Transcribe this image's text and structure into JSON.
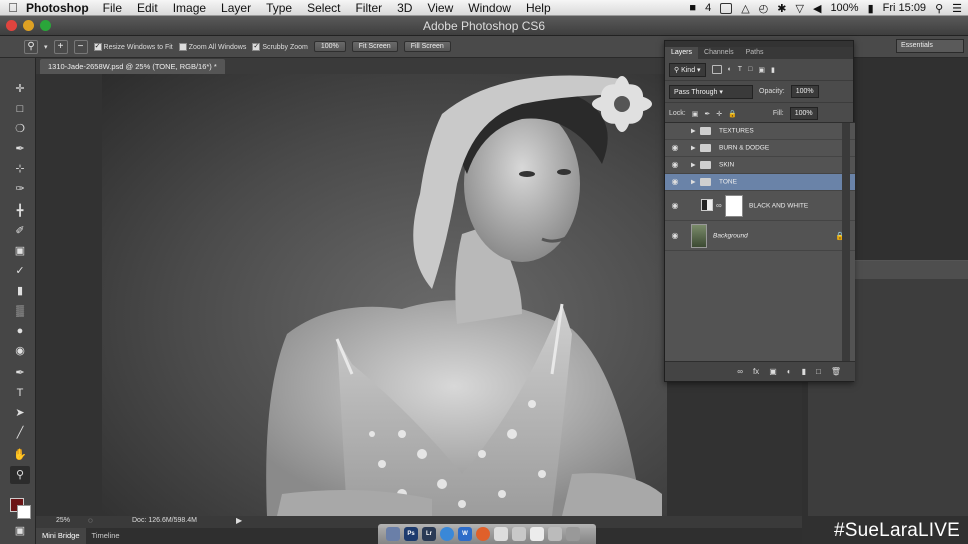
{
  "menubar": {
    "app_name": "Photoshop",
    "items": [
      "File",
      "Edit",
      "Image",
      "Layer",
      "Type",
      "Select",
      "Filter",
      "3D",
      "View",
      "Window",
      "Help"
    ],
    "battery": "100%",
    "clock": "Fri 15:09",
    "indicator": "4"
  },
  "window": {
    "title": "Adobe Photoshop CS6"
  },
  "options_bar": {
    "resize_windows_label": "Resize Windows to Fit",
    "zoom_all_label": "Zoom All Windows",
    "scrubby_zoom_label": "Scrubby Zoom",
    "percent_btn": "100%",
    "fit_screen_btn": "Fit Screen",
    "fill_screen_btn": "Fill Screen",
    "workspace": "Essentials"
  },
  "document": {
    "tab_title": "1310-Jade-2658W.psd @ 25% (TONE, RGB/16*) *"
  },
  "layers_panel": {
    "tabs": [
      "Layers",
      "Channels",
      "Paths"
    ],
    "filter_kind": "Kind",
    "blend_mode": "Pass Through",
    "opacity_label": "Opacity:",
    "opacity_value": "100%",
    "lock_label": "Lock:",
    "fill_label": "Fill:",
    "fill_value": "100%",
    "layers": [
      {
        "name": "TEXTURES",
        "type": "group",
        "visible": false
      },
      {
        "name": "BURN & DODGE",
        "type": "group",
        "visible": true
      },
      {
        "name": "SKIN",
        "type": "group",
        "visible": true
      },
      {
        "name": "TONE",
        "type": "group",
        "visible": true,
        "selected": true
      },
      {
        "name": "BLACK AND WHITE",
        "type": "adjustment",
        "visible": true
      },
      {
        "name": "Background",
        "type": "image",
        "visible": true,
        "locked": true
      }
    ]
  },
  "status_bar": {
    "zoom": "25%",
    "doc_info": "Doc: 126.6M/598.4M"
  },
  "bottom_tabs": [
    "Mini Bridge",
    "Timeline"
  ],
  "colors": {
    "foreground": "#6b1416",
    "background": "#ffffff",
    "selected_layer": "#6a83a8"
  },
  "watermark": "#SueLaraLIVE"
}
